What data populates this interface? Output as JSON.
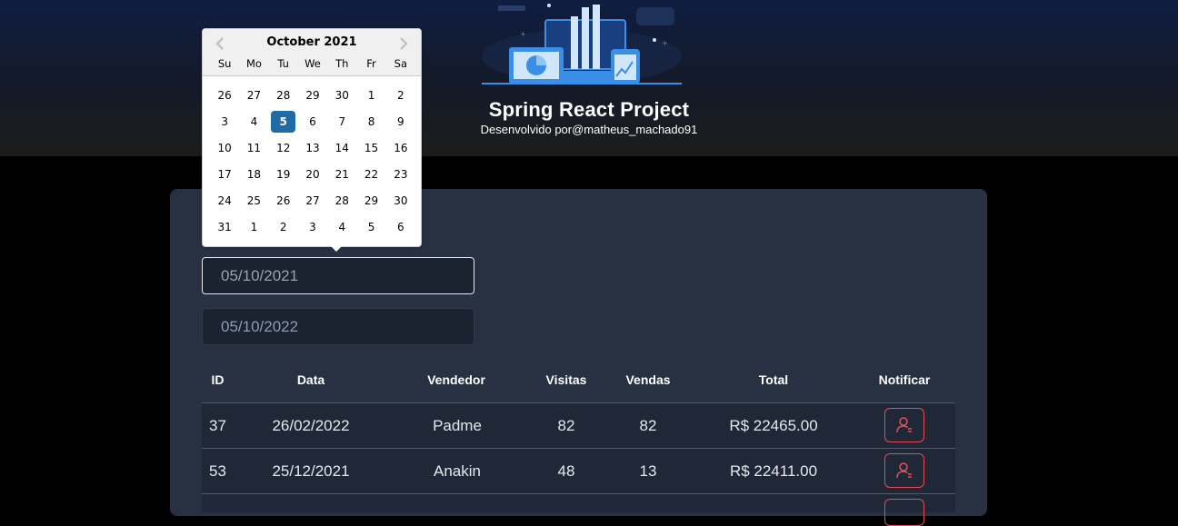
{
  "header": {
    "title": "Spring React Project",
    "subtitle": "Desenvolvido por@matheus_machado91",
    "logo_icon": "dashboard-illustration"
  },
  "filters": {
    "min_date": "05/10/2021",
    "max_date": "05/10/2022"
  },
  "datepicker": {
    "month_label": "October 2021",
    "prev_icon": "chevron-left-icon",
    "next_icon": "chevron-right-icon",
    "day_names": [
      "Su",
      "Mo",
      "Tu",
      "We",
      "Th",
      "Fr",
      "Sa"
    ],
    "selected_day": "5",
    "selected_color": "#216ba5",
    "weeks": [
      [
        "26",
        "27",
        "28",
        "29",
        "30",
        "1",
        "2"
      ],
      [
        "3",
        "4",
        "5",
        "6",
        "7",
        "8",
        "9"
      ],
      [
        "10",
        "11",
        "12",
        "13",
        "14",
        "15",
        "16"
      ],
      [
        "17",
        "18",
        "19",
        "20",
        "21",
        "22",
        "23"
      ],
      [
        "24",
        "25",
        "26",
        "27",
        "28",
        "29",
        "30"
      ],
      [
        "31",
        "1",
        "2",
        "3",
        "4",
        "5",
        "6"
      ]
    ]
  },
  "table": {
    "headers": {
      "id": "ID",
      "date": "Data",
      "seller": "Vendedor",
      "visits": "Visitas",
      "deals": "Vendas",
      "total": "Total",
      "notify": "Notificar"
    },
    "rows": [
      {
        "id": "37",
        "date": "26/02/2022",
        "seller": "Padme",
        "visits": "82",
        "deals": "82",
        "total": "R$ 22465.00",
        "notify_icon": "user-notify-icon"
      },
      {
        "id": "53",
        "date": "25/12/2021",
        "seller": "Anakin",
        "visits": "48",
        "deals": "13",
        "total": "R$ 22411.00",
        "notify_icon": "user-notify-icon"
      }
    ]
  },
  "colors": {
    "accent_red": "#e54c5b",
    "card_bg": "#283142",
    "header_top": "#0f1d40"
  }
}
